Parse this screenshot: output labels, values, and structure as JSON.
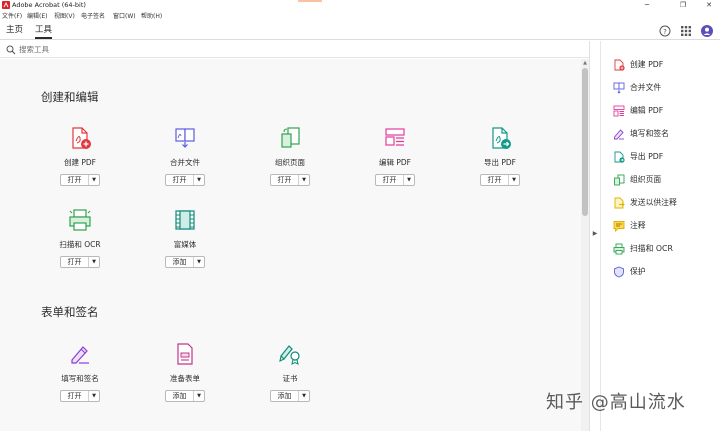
{
  "window": {
    "title": "Adobe Acrobat (64-bit)"
  },
  "menu": [
    "文件(F)",
    "编辑(E)",
    "视图(V)",
    "电子签名",
    "窗口(W)",
    "帮助(H)"
  ],
  "tabs": {
    "home": "主页",
    "tools": "工具"
  },
  "search": {
    "placeholder": "搜索工具"
  },
  "sections": [
    {
      "title": "创建和编辑",
      "tools": [
        {
          "name": "创建 PDF",
          "button": "打开",
          "icon": "create-pdf-icon",
          "color": "#e0393e"
        },
        {
          "name": "合并文件",
          "button": "打开",
          "icon": "combine-files-icon",
          "color": "#5c5ce0"
        },
        {
          "name": "组织页面",
          "button": "打开",
          "icon": "organize-pages-icon",
          "color": "#2ea44f"
        },
        {
          "name": "编辑 PDF",
          "button": "打开",
          "icon": "edit-pdf-icon",
          "color": "#e33d9b"
        },
        {
          "name": "导出 PDF",
          "button": "打开",
          "icon": "export-pdf-icon",
          "color": "#10998a"
        },
        {
          "name": "扫描和 OCR",
          "button": "打开",
          "icon": "scan-ocr-icon",
          "color": "#2ea44f"
        },
        {
          "name": "富媒体",
          "button": "添加",
          "icon": "rich-media-icon",
          "color": "#0d8a7a"
        }
      ]
    },
    {
      "title": "表单和签名",
      "tools": [
        {
          "name": "填写和签名",
          "button": "打开",
          "icon": "fill-sign-icon",
          "color": "#8c3fd6"
        },
        {
          "name": "准备表单",
          "button": "添加",
          "icon": "prepare-form-icon",
          "color": "#c1368e"
        },
        {
          "name": "证书",
          "button": "添加",
          "icon": "certificate-icon",
          "color": "#0d8a7a"
        }
      ]
    }
  ],
  "right_panel": [
    {
      "label": "创建 PDF",
      "icon": "create-pdf-icon",
      "color": "#e0393e"
    },
    {
      "label": "合并文件",
      "icon": "combine-files-icon",
      "color": "#5c5ce0"
    },
    {
      "label": "编辑 PDF",
      "icon": "edit-pdf-icon",
      "color": "#e33d9b"
    },
    {
      "label": "填写和签名",
      "icon": "fill-sign-icon",
      "color": "#8c3fd6"
    },
    {
      "label": "导出 PDF",
      "icon": "export-pdf-icon",
      "color": "#10998a"
    },
    {
      "label": "组织页面",
      "icon": "organize-pages-icon",
      "color": "#2ea44f"
    },
    {
      "label": "发送以供注释",
      "icon": "send-comments-icon",
      "color": "#e0b100"
    },
    {
      "label": "注释",
      "icon": "comment-icon",
      "color": "#e0b100"
    },
    {
      "label": "扫描和 OCR",
      "icon": "scan-ocr-icon",
      "color": "#2ea44f"
    },
    {
      "label": "保护",
      "icon": "protect-icon",
      "color": "#5c5ce0"
    }
  ],
  "watermark": "知乎 @高山流水"
}
